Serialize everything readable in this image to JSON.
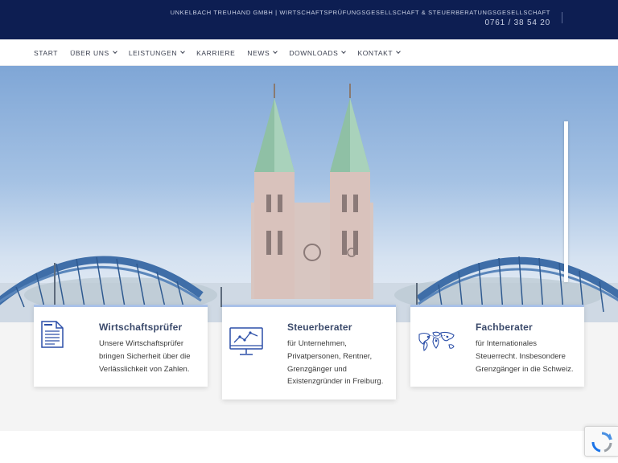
{
  "topbar": {
    "company": "UNKELBACH TREUHAND GMBH | WIRTSCHAFTSPRÜFUNGSGESELLSCHAFT & STEUERBERATUNGSGESELLSCHAFT",
    "phone": "0761 / 38 54 20"
  },
  "nav": {
    "items": [
      {
        "label": "START",
        "dropdown": false
      },
      {
        "label": "ÜBER UNS",
        "dropdown": true
      },
      {
        "label": "LEISTUNGEN",
        "dropdown": true
      },
      {
        "label": "KARRIERE",
        "dropdown": false
      },
      {
        "label": "NEWS",
        "dropdown": true
      },
      {
        "label": "DOWNLOADS",
        "dropdown": true
      },
      {
        "label": "KONTAKT",
        "dropdown": true
      }
    ]
  },
  "cards": [
    {
      "title": "Wirtschaftsprüfer",
      "text": "Unsere Wirtschaftsprüfer bringen Sicherheit über die Verlässlichkeit von Zahlen.",
      "icon": "document-icon"
    },
    {
      "title": "Steuerberater",
      "text": "für Unternehmen, Privatpersonen, Rentner, Grenzgänger und Existenzgründer in Freiburg.",
      "icon": "monitor-chart-icon"
    },
    {
      "title": "Fachberater",
      "text": "für Internationales Steuerrecht. Insbesondere Grenzgänger in die Schweiz.",
      "icon": "world-map-icon"
    }
  ],
  "colors": {
    "topbar": "#0d1e52",
    "accent": "#2c4fa8",
    "card_border": "#a9c1e8"
  }
}
